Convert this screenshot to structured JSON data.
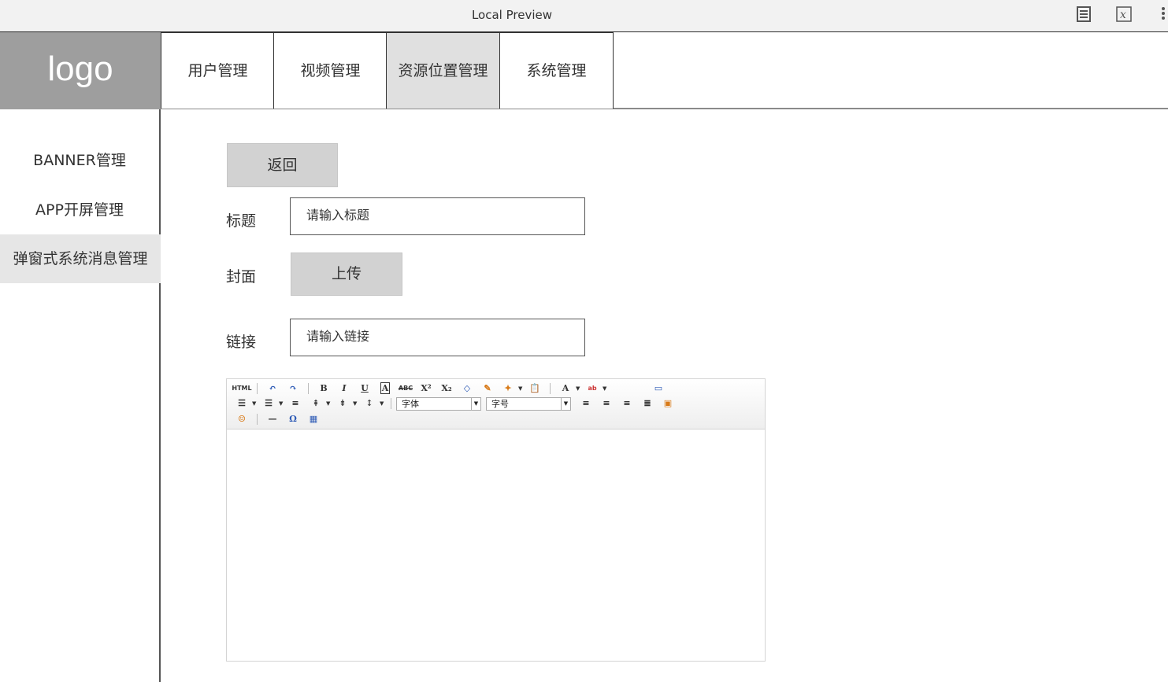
{
  "window": {
    "title": "Local Preview"
  },
  "logo": {
    "text": "logo"
  },
  "topnav": {
    "tabs": [
      {
        "label": "用户管理"
      },
      {
        "label": "视频管理"
      },
      {
        "label": "资源位置管理"
      },
      {
        "label": "系统管理"
      }
    ]
  },
  "sidebar": {
    "items": [
      {
        "label": "BANNER管理"
      },
      {
        "label": "APP开屏管理"
      },
      {
        "label": "弹窗式系统消息管理"
      }
    ]
  },
  "form": {
    "back_label": "返回",
    "title_label": "标题",
    "title_placeholder": "请输入标题",
    "cover_label": "封面",
    "upload_label": "上传",
    "link_label": "链接",
    "link_placeholder": "请输入链接"
  },
  "editor": {
    "html_label": "HTML",
    "font_family_value": "字体",
    "font_size_value": "字号"
  }
}
